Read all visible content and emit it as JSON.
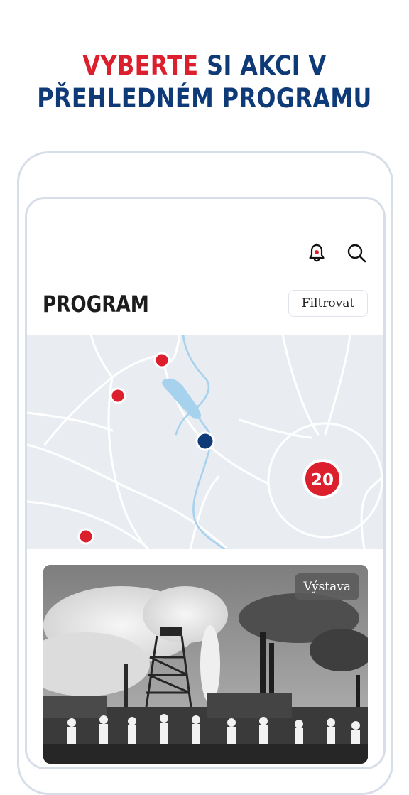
{
  "headline": {
    "accent_word": "VYBERTE",
    "line1_rest": " SI AKCI V",
    "line2": "PŘEHLEDNÉM PROGRAMU"
  },
  "header": {
    "icons": [
      "bell-icon",
      "search-icon"
    ]
  },
  "page": {
    "title": "PROGRAM",
    "filter_label": "Filtrovat"
  },
  "map": {
    "cluster_count": "20"
  },
  "card": {
    "tag": "Výstava"
  },
  "colors": {
    "brand_red": "#dc1f2d",
    "brand_blue": "#0f3a78",
    "map_bg": "#e9edf2",
    "water": "#a7d2ee"
  }
}
